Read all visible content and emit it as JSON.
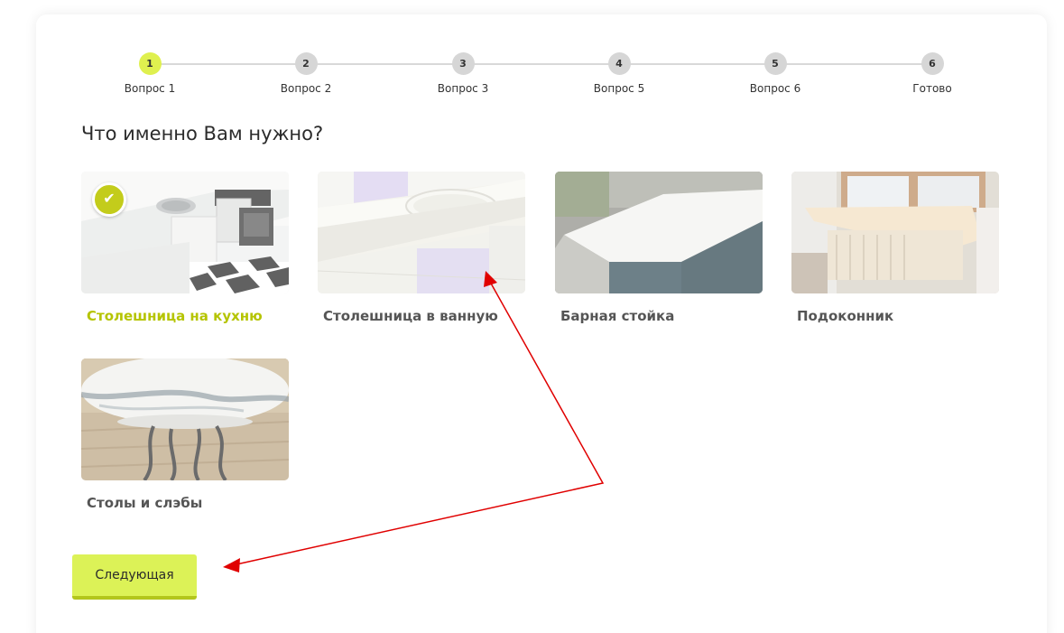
{
  "stepper": {
    "steps": [
      {
        "num": "1",
        "label": "Вопрос 1",
        "active": true
      },
      {
        "num": "2",
        "label": "Вопрос 2",
        "active": false
      },
      {
        "num": "3",
        "label": "Вопрос 3",
        "active": false
      },
      {
        "num": "4",
        "label": "Вопрос 5",
        "active": false
      },
      {
        "num": "5",
        "label": "Вопрос 6",
        "active": false
      },
      {
        "num": "6",
        "label": "Готово",
        "active": false
      }
    ]
  },
  "question": "Что именно Вам нужно?",
  "options": [
    {
      "name": "Столешница на кухню",
      "selected": true,
      "icon": "kitchen-countertop-photo"
    },
    {
      "name": "Столешница в ванную",
      "selected": false,
      "icon": "bathroom-countertop-photo"
    },
    {
      "name": "Барная стойка",
      "selected": false,
      "icon": "bar-counter-photo"
    },
    {
      "name": "Подоконник",
      "selected": false,
      "icon": "window-sill-photo"
    },
    {
      "name": "Столы и слэбы",
      "selected": false,
      "icon": "table-photo"
    }
  ],
  "check_mark": "✔",
  "next_button": "Следующая",
  "colors": {
    "accent": "#dcf257",
    "accent_dark": "#b3c61c",
    "selected_text": "#b5c400",
    "annotation_arrow": "#e00000"
  }
}
